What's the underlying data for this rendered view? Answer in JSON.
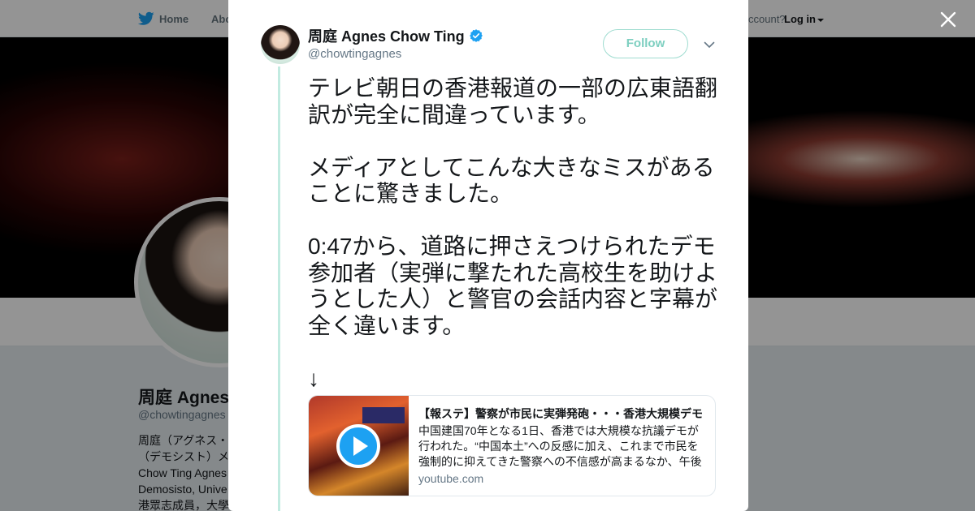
{
  "background": {
    "nav": {
      "home_label": "Home",
      "about_label": "Abo",
      "account_label": "ccount?",
      "login_label": "Log in"
    },
    "profile": {
      "name": "周庭 Agnes",
      "handle": "@chowtingagnes",
      "bio": "周庭（アグネス・\n（デモシスト）メ\nChow Ting Agnes\nDemosisto, Unive\n港眾志成員，大學"
    }
  },
  "tweet": {
    "author_name": "周庭 Agnes Chow Ting",
    "author_handle": "@chowtingagnes",
    "verified": true,
    "follow_label": "Follow",
    "text": "テレビ朝日の香港報道の一部の広東語翻訳が完全に間違っています。\n\nメディアとしてこんな大きなミスがあることに驚きました。\n\n0:47から、道路に押さえつけられたデモ参加者（実弾に撃たれた高校生を助けようとした人）と警官の会話内容と字幕が全く違います。\n\n↓",
    "card": {
      "title": "【報ステ】警察が市民に実弾発砲・・・香港大規模デモ",
      "description": "中国建国70年となる1日、香港では大規模な抗議デモが行われた。“中国本土”への反感に加え、これまで市民を強制的に抑えてきた警察への不信感が高まるなか、午後",
      "domain": "youtube.com"
    }
  },
  "colors": {
    "accent": "#1da1f2",
    "follow_border": "#9fdcd0",
    "follow_text": "#7dcfc0",
    "thread_line": "#c2ebe1"
  }
}
